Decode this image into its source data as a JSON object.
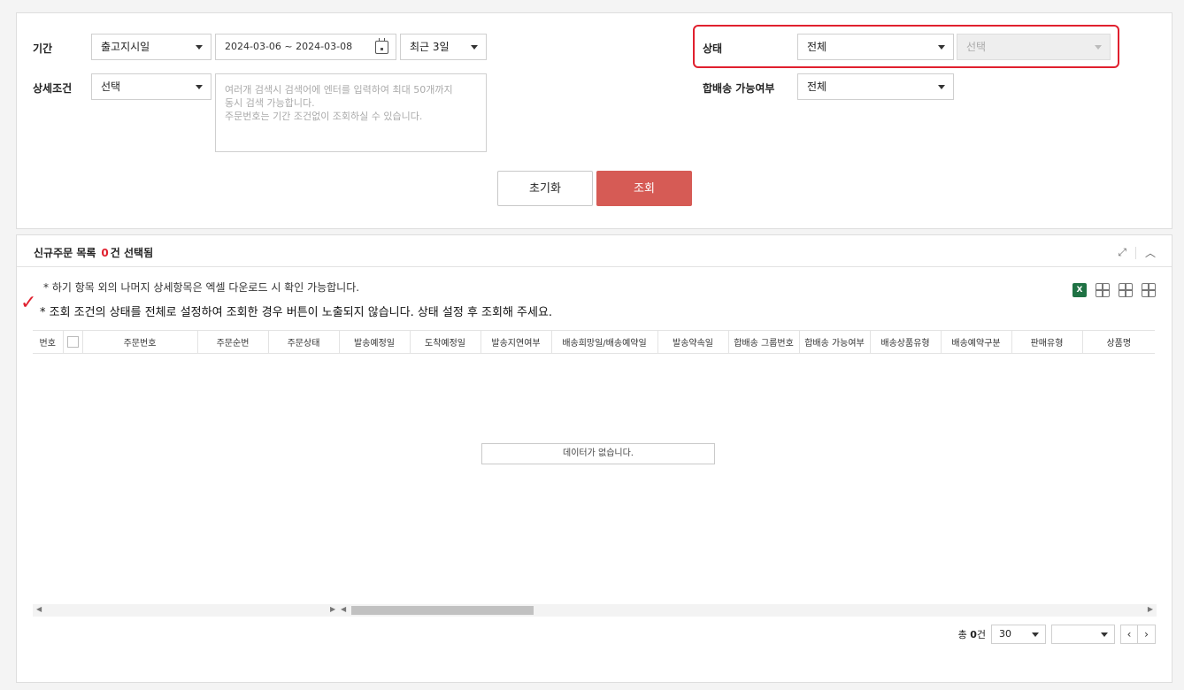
{
  "search": {
    "period_label": "기간",
    "period_type": "출고지시일",
    "date_range": "2024-03-06 ~ 2024-03-08",
    "quick_range": "최근 3일",
    "detail_label": "상세조건",
    "detail_select": "선택",
    "detail_placeholder": "여러개 검색시 검색어에 엔터를 입력하여 최대 50개까지\n동시 검색 가능합니다.\n주문번호는 기간 조건없이 조회하실 수 있습니다.",
    "status_label": "상태",
    "status_value": "전체",
    "status_sub_value": "선택",
    "combined_label": "합배송 가능여부",
    "combined_value": "전체",
    "reset_label": "초기화",
    "search_label": "조회"
  },
  "list": {
    "title": "신규주문 목록",
    "count": "0",
    "count_suffix": "건 선택됨",
    "note1": "* 하기 항목 외의 나머지 상세항목은 엑셀 다운로드 시 확인 가능합니다.",
    "note2": "* 조회 조건의 상태를 전체로 설정하여 조회한 경우 버튼이 노출되지 않습니다. 상태 설정 후 조회해 주세요.",
    "columns": [
      "번호",
      "",
      "주문번호",
      "주문순번",
      "주문상태",
      "발송예정일",
      "도착예정일",
      "발송지연여부",
      "배송희망일/배송예약일",
      "발송약속일",
      "합배송 그룹번호",
      "합배송 가능여부",
      "배송상품유형",
      "배송예약구분",
      "판매유형",
      "상품명"
    ],
    "empty_message": "데이터가 없습니다.",
    "total_prefix": "총",
    "total_count": "0",
    "total_suffix": "건",
    "page_size": "30",
    "excel_label": "X"
  },
  "colors": {
    "accent_red": "#e0202e",
    "search_button": "#d65b55",
    "excel_green": "#1f7244"
  }
}
